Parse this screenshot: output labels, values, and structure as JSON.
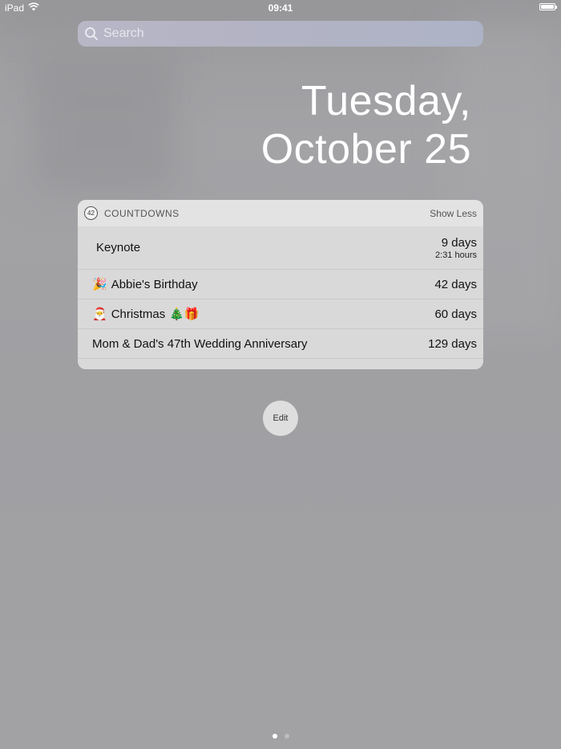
{
  "status_bar": {
    "device": "iPad",
    "time": "09:41"
  },
  "search": {
    "placeholder": "Search"
  },
  "date": {
    "weekday": "Tuesday,",
    "day": "October 25"
  },
  "widget": {
    "app_icon_text": "42",
    "title": "COUNTDOWNS",
    "show_less_label": "Show Less",
    "items": [
      {
        "emoji_before": "",
        "name": "Keynote",
        "emoji_after": "",
        "days": "9 days",
        "sub": "2:31 hours"
      },
      {
        "emoji_before": "🎉",
        "name": "Abbie's Birthday",
        "emoji_after": "",
        "days": "42 days",
        "sub": ""
      },
      {
        "emoji_before": "🎅",
        "name": "Christmas",
        "emoji_after": "🎄🎁",
        "days": "60 days",
        "sub": ""
      },
      {
        "emoji_before": "",
        "name": "Mom & Dad's 47th Wedding Anniversary",
        "emoji_after": "",
        "days": "129 days",
        "sub": ""
      }
    ]
  },
  "edit_label": "Edit",
  "page_indicator": {
    "count": 2,
    "active_index": 0
  },
  "icons": {
    "wifi": "wifi-icon",
    "battery": "battery-icon",
    "search": "search-icon",
    "app": "countdowns-app-icon"
  },
  "colors": {
    "background": "#a0a0a3",
    "widget_background": "#d9d9d9",
    "widget_header": "#e3e3e3",
    "text_white": "#ffffff"
  }
}
